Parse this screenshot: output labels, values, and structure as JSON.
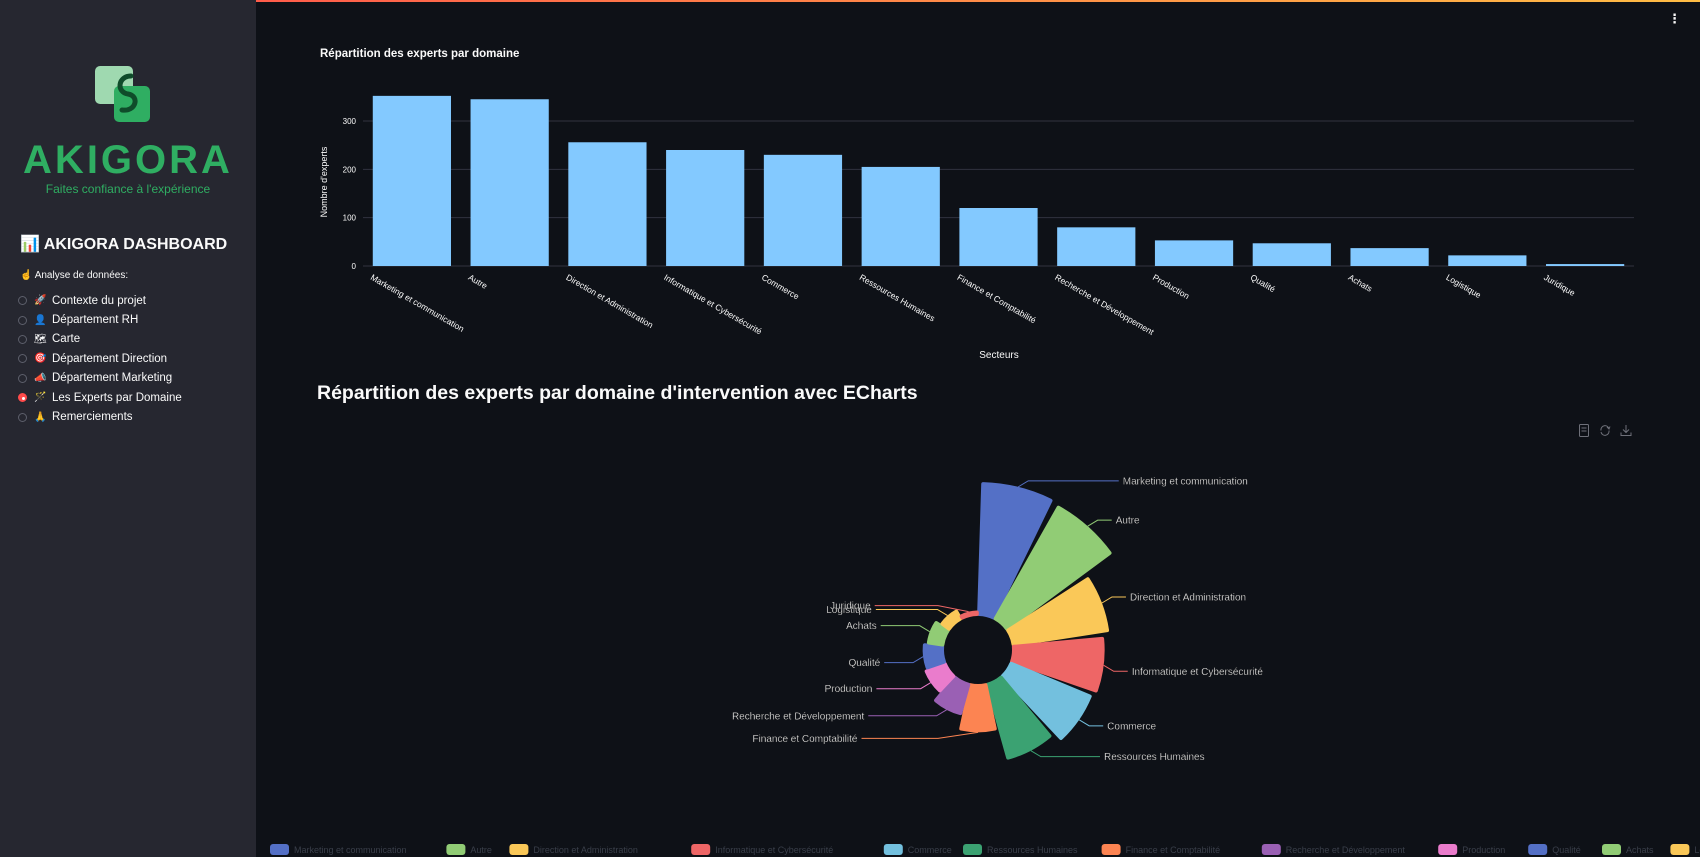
{
  "brand": {
    "name": "AKIGORA",
    "tagline": "Faites confiance à l'expérience"
  },
  "sidebar": {
    "title": "AKIGORA DASHBOARD",
    "title_icon": "chart-icon",
    "subtitle": "Analyse de données:",
    "subtitle_icon": "pointing-hand-icon",
    "items": [
      {
        "label": "Contexte du projet",
        "icon": "rocket-icon",
        "emoji": "🚀",
        "selected": false
      },
      {
        "label": "Département RH",
        "icon": "person-icon",
        "emoji": "👤",
        "selected": false
      },
      {
        "label": "Carte",
        "icon": "map-icon",
        "emoji": "🗺",
        "selected": false
      },
      {
        "label": "Département Direction",
        "icon": "target-icon",
        "emoji": "🎯",
        "selected": false
      },
      {
        "label": "Département Marketing",
        "icon": "megaphone-icon",
        "emoji": "📣",
        "selected": false
      },
      {
        "label": "Les Experts par Domaine",
        "icon": "wand-icon",
        "emoji": "🪄",
        "selected": true
      },
      {
        "label": "Remerciements",
        "icon": "praying-hands-icon",
        "emoji": "🙏",
        "selected": false
      }
    ]
  },
  "colors": {
    "bar": "#83c9ff",
    "pie": [
      "#5470c6",
      "#91cc75",
      "#fac858",
      "#ee6666",
      "#73c0de",
      "#3ba272",
      "#fc8452",
      "#9a60b4",
      "#ea7ccc",
      "#5470c6",
      "#91cc75",
      "#fac858",
      "#ee6666"
    ]
  },
  "section_heading": "Répartition des experts par domaine d'intervention avec ECharts",
  "chart_data": [
    {
      "type": "bar",
      "title": "Répartition des experts par domaine",
      "xlabel": "Secteurs",
      "ylabel": "Nombre d'experts",
      "ylim": [
        0,
        360
      ],
      "yticks": [
        0,
        100,
        200,
        300
      ],
      "categories": [
        "Marketing et communication",
        "Autre",
        "Direction et Administration",
        "Informatique et Cybersécurité",
        "Commerce",
        "Ressources Humaines",
        "Finance et Comptabilité",
        "Recherche et Développement",
        "Production",
        "Qualité",
        "Achats",
        "Logistique",
        "Juridique"
      ],
      "values": [
        352,
        345,
        256,
        240,
        230,
        205,
        120,
        80,
        53,
        47,
        37,
        22,
        4
      ],
      "grid": true
    },
    {
      "type": "pie",
      "subtype": "rose",
      "categories": [
        "Marketing et communication",
        "Autre",
        "Direction et Administration",
        "Informatique et Cybersécurité",
        "Commerce",
        "Ressources Humaines",
        "Finance et Comptabilité",
        "Recherche et Développement",
        "Production",
        "Qualité",
        "Achats",
        "Logistique",
        "Juridique"
      ],
      "values": [
        352,
        345,
        256,
        240,
        230,
        205,
        120,
        80,
        53,
        47,
        37,
        22,
        4
      ],
      "legend_position": "bottom"
    }
  ]
}
